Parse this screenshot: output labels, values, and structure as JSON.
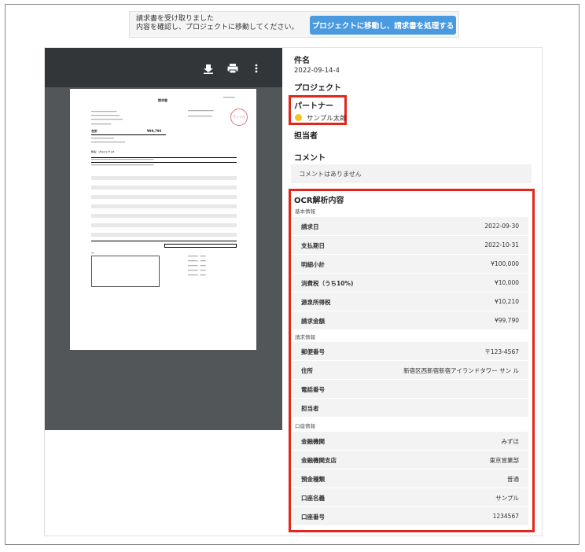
{
  "banner": {
    "line1": "請求書を受け取りました",
    "line2": "内容を確認し、プロジェクトに移動してください。",
    "button": "プロジェクトに移動し、請求書を処理する"
  },
  "viewer": {
    "icons": [
      "download-icon",
      "print-icon",
      "more-vert-icon"
    ],
    "pdf": {
      "title": "請求書",
      "total_label": "合計",
      "total_value": "¥99,790",
      "stamp": "サンプル",
      "project_heading": "件名：プロジェクトA"
    }
  },
  "details": {
    "subject_label": "件名",
    "subject_value": "2022-09-14-4",
    "project_label": "プロジェクト",
    "partner_label": "パートナー",
    "partner_value": "サンプル太郎",
    "owner_label": "担当者",
    "comment_label": "コメント",
    "comment_value": "コメントはありません"
  },
  "ocr": {
    "title": "OCR解析内容",
    "sections": [
      {
        "name": "基本情報",
        "rows": [
          {
            "k": "請求日",
            "v": "2022-09-30"
          },
          {
            "k": "支払期日",
            "v": "2022-10-31"
          },
          {
            "k": "明細小計",
            "v": "¥100,000"
          },
          {
            "k": "消費税（うち10%)",
            "v": "¥10,000"
          },
          {
            "k": "源泉所得税",
            "v": "¥10,210"
          },
          {
            "k": "請求金額",
            "v": "¥99,790"
          }
        ]
      },
      {
        "name": "請求情報",
        "rows": [
          {
            "k": "郵便番号",
            "v": "〒123-4567"
          },
          {
            "k": "住所",
            "v": "新宿区西新宿新宿アイランドタワー サン ル"
          },
          {
            "k": "電話番号",
            "v": ""
          },
          {
            "k": "担当者",
            "v": ""
          }
        ]
      },
      {
        "name": "口座情報",
        "rows": [
          {
            "k": "金融機関",
            "v": "みずほ"
          },
          {
            "k": "金融機関支店",
            "v": "東京営業部"
          },
          {
            "k": "預金種類",
            "v": "普通"
          },
          {
            "k": "口座名義",
            "v": "サンプル"
          },
          {
            "k": "口座番号",
            "v": "1234567"
          }
        ]
      }
    ]
  },
  "colors": {
    "highlight": "#e4261a",
    "button": "#4a9ae0",
    "viewer_bg": "#525659",
    "viewer_bar": "#323639"
  }
}
